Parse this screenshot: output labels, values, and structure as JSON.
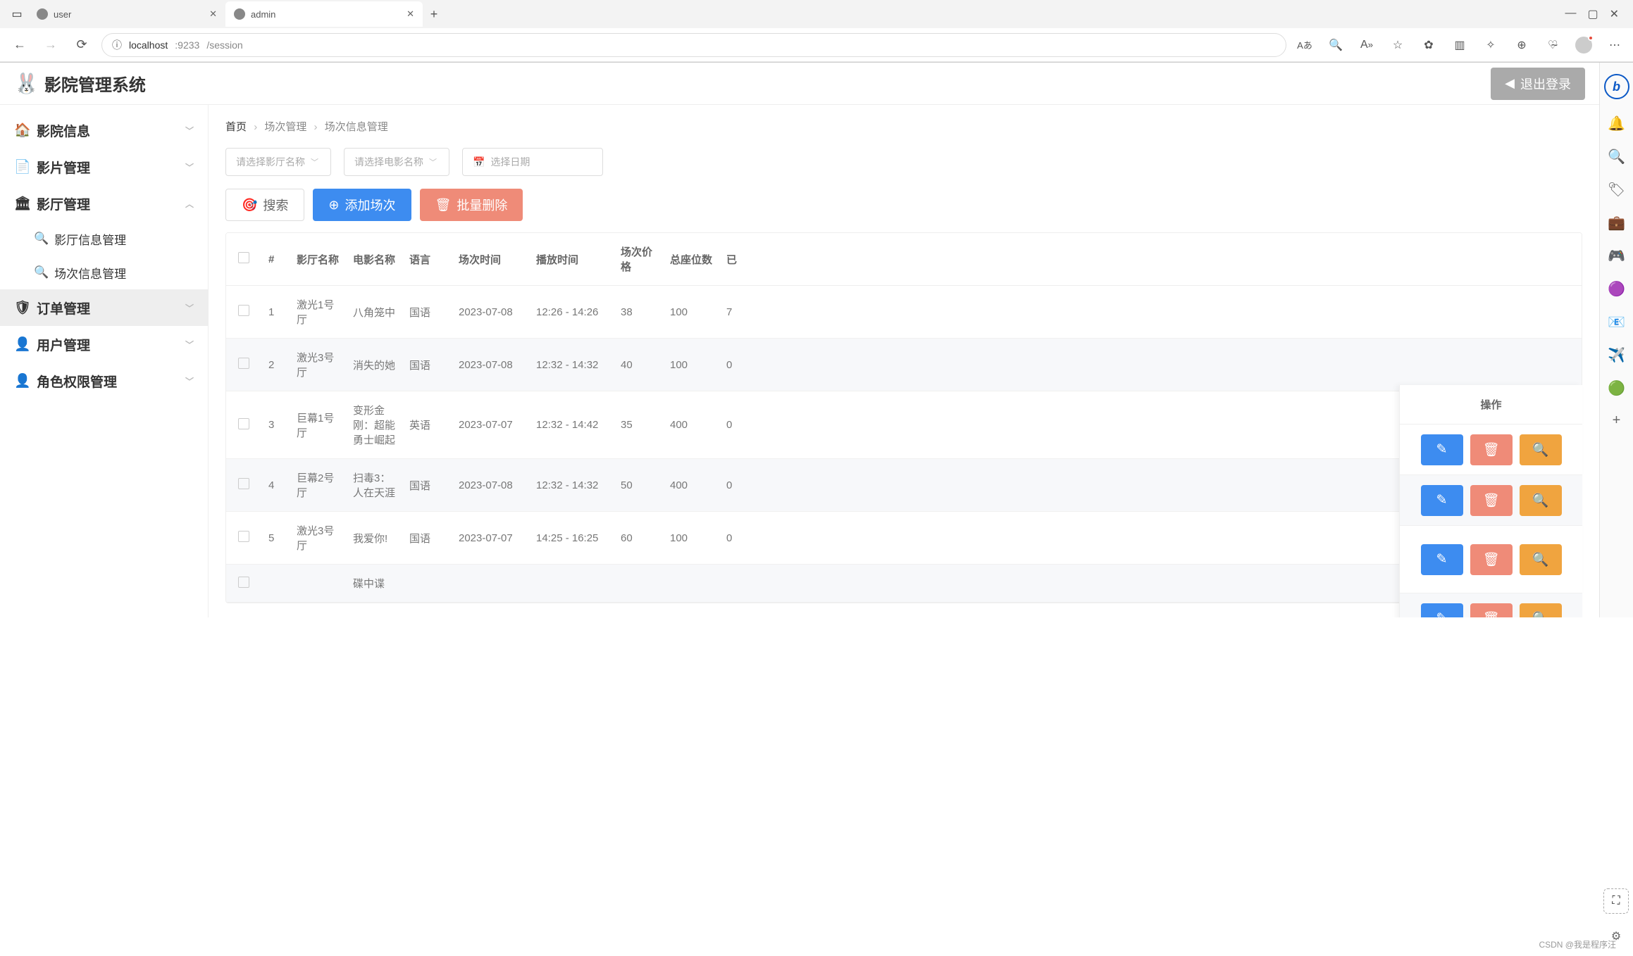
{
  "browser": {
    "tabs": [
      {
        "title": "user",
        "active": false
      },
      {
        "title": "admin",
        "active": true
      }
    ],
    "url_host": "localhost",
    "url_port": ":9233",
    "url_path": "/session",
    "toolbar": {
      "lang": "Aあ"
    }
  },
  "app": {
    "title": "影院管理系统",
    "logout": "退出登录"
  },
  "sidebar": {
    "items": [
      {
        "icon": "🏠",
        "label": "影院信息",
        "expandable": true
      },
      {
        "icon": "📄",
        "label": "影片管理",
        "expandable": true
      },
      {
        "icon": "🏛",
        "label": "影厅管理",
        "expandable": true,
        "children": [
          {
            "label": "影厅信息管理"
          },
          {
            "label": "场次信息管理"
          }
        ]
      },
      {
        "icon": "🛡",
        "label": "订单管理",
        "expandable": true,
        "hover": true
      },
      {
        "icon": "👤",
        "label": "用户管理",
        "expandable": true
      },
      {
        "icon": "👤",
        "label": "角色权限管理",
        "expandable": true
      }
    ]
  },
  "breadcrumb": {
    "home": "首页",
    "level1": "场次管理",
    "level2": "场次信息管理"
  },
  "filters": {
    "hall_placeholder": "请选择影厅名称",
    "movie_placeholder": "请选择电影名称",
    "date_placeholder": "选择日期"
  },
  "actions": {
    "search": "搜索",
    "add": "添加场次",
    "bulk_delete": "批量删除"
  },
  "table": {
    "headers": {
      "idx": "#",
      "hall": "影厅名称",
      "movie": "电影名称",
      "lang": "语言",
      "date": "场次时间",
      "time": "播放时间",
      "price": "场次价格",
      "seats": "总座位数",
      "extra": "已",
      "ops": "操作"
    },
    "rows": [
      {
        "idx": "1",
        "hall": "激光1号厅",
        "movie": "八角笼中",
        "lang": "国语",
        "date": "2023-07-08",
        "time": "12:26 - 14:26",
        "price": "38",
        "seats": "100",
        "extra": "7"
      },
      {
        "idx": "2",
        "hall": "激光3号厅",
        "movie": "消失的她",
        "lang": "国语",
        "date": "2023-07-08",
        "time": "12:32 - 14:32",
        "price": "40",
        "seats": "100",
        "extra": "0"
      },
      {
        "idx": "3",
        "hall": "巨幕1号厅",
        "movie": "变形金刚：超能勇士崛起",
        "lang": "英语",
        "date": "2023-07-07",
        "time": "12:32 - 14:42",
        "price": "35",
        "seats": "400",
        "extra": "0"
      },
      {
        "idx": "4",
        "hall": "巨幕2号厅",
        "movie": "扫毒3：人在天涯",
        "lang": "国语",
        "date": "2023-07-08",
        "time": "12:32 - 14:32",
        "price": "50",
        "seats": "400",
        "extra": "0"
      },
      {
        "idx": "5",
        "hall": "激光3号厅",
        "movie": "我爱你!",
        "lang": "国语",
        "date": "2023-07-07",
        "time": "14:25 - 16:25",
        "price": "60",
        "seats": "100",
        "extra": "0"
      },
      {
        "idx": "",
        "hall": "",
        "movie": "碟中谍",
        "lang": "",
        "date": "",
        "time": "",
        "price": "",
        "seats": "",
        "extra": ""
      }
    ]
  },
  "watermark": "CSDN @我是程序汪"
}
